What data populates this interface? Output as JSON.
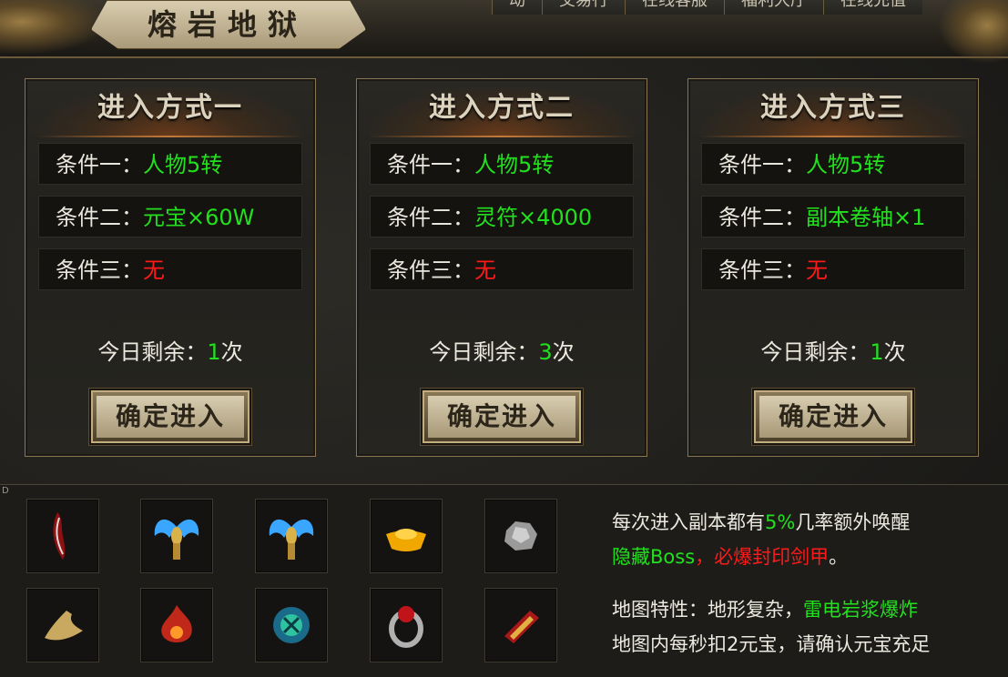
{
  "header": {
    "title": "熔岩地狱",
    "tabs": [
      "动",
      "交易行",
      "在线客服",
      "福利大厅",
      "在线充值"
    ]
  },
  "panels": [
    {
      "title": "进入方式一",
      "conditions": [
        {
          "label": "条件一：",
          "value": "人物5转",
          "color": "green"
        },
        {
          "label": "条件二：",
          "value": "元宝×60W",
          "color": "green"
        },
        {
          "label": "条件三：",
          "value": "无",
          "color": "red"
        }
      ],
      "remain_label": "今日剩余：",
      "remain_count": "1",
      "remain_unit": "次",
      "button": "确定进入"
    },
    {
      "title": "进入方式二",
      "conditions": [
        {
          "label": "条件一：",
          "value": "人物5转",
          "color": "green"
        },
        {
          "label": "条件二：",
          "value": "灵符×4000",
          "color": "green"
        },
        {
          "label": "条件三：",
          "value": "无",
          "color": "red"
        }
      ],
      "remain_label": "今日剩余：",
      "remain_count": "3",
      "remain_unit": "次",
      "button": "确定进入"
    },
    {
      "title": "进入方式三",
      "conditions": [
        {
          "label": "条件一：",
          "value": "人物5转",
          "color": "green"
        },
        {
          "label": "条件二：",
          "value": "副本卷轴×1",
          "color": "green"
        },
        {
          "label": "条件三：",
          "value": "无",
          "color": "red"
        }
      ],
      "remain_label": "今日剩余：",
      "remain_count": "1",
      "remain_unit": "次",
      "button": "确定进入"
    }
  ],
  "corner_mark": "D",
  "rewards": [
    {
      "icon": "blood-blade-icon"
    },
    {
      "icon": "ice-wing-armor-icon"
    },
    {
      "icon": "ice-wing-armor-icon"
    },
    {
      "icon": "gold-ingot-icon"
    },
    {
      "icon": "silver-ore-icon"
    },
    {
      "icon": "gold-horn-icon"
    },
    {
      "icon": "fire-orb-icon"
    },
    {
      "icon": "jade-orb-icon"
    },
    {
      "icon": "ruby-ring-icon"
    },
    {
      "icon": "flame-bracer-icon"
    }
  ],
  "info": {
    "line1_a": "每次进入副本都有",
    "line1_b": "5%",
    "line1_c": "几率额外唤醒",
    "line2_a": "隐藏Boss",
    "line2_b": "，必爆封印剑甲",
    "line2_c": "。",
    "line3_a": "地图特性：地形复杂，",
    "line3_b": "雷电岩浆爆炸",
    "line4": "地图内每秒扣2元宝，请确认元宝充足"
  },
  "colors": {
    "green": "#22e01e",
    "red": "#ff1a1a",
    "gold": "#8a7650"
  }
}
